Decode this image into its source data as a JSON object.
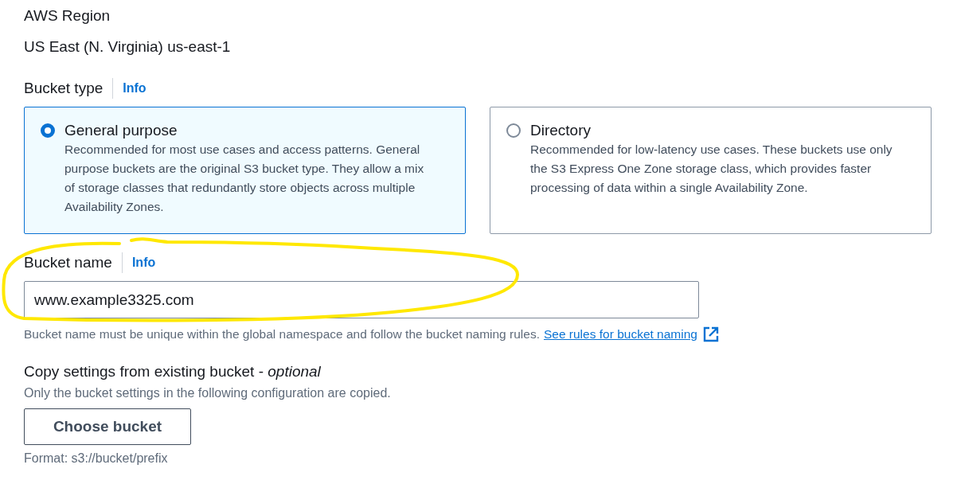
{
  "aws_region": {
    "label": "AWS Region",
    "value": "US East (N. Virginia) us-east-1"
  },
  "bucket_type": {
    "label": "Bucket type",
    "info": "Info",
    "options": [
      {
        "title": "General purpose",
        "description": "Recommended for most use cases and access patterns. General purpose buckets are the original S3 bucket type. They allow a mix of storage classes that redundantly store objects across multiple Availability Zones.",
        "selected": true
      },
      {
        "title": "Directory",
        "description": "Recommended for low-latency use cases. These buckets use only the S3 Express One Zone storage class, which provides faster processing of data within a single Availability Zone.",
        "selected": false
      }
    ]
  },
  "bucket_name": {
    "label": "Bucket name",
    "info": "Info",
    "value": "www.example3325.com",
    "help": "Bucket name must be unique within the global namespace and follow the bucket naming rules.",
    "link": "See rules for bucket naming"
  },
  "copy_settings": {
    "label": "Copy settings from existing bucket - *optional*",
    "description": "Only the bucket settings in the following configuration are copied.",
    "button": "Choose bucket",
    "format": "Format: s3://bucket/prefix"
  }
}
